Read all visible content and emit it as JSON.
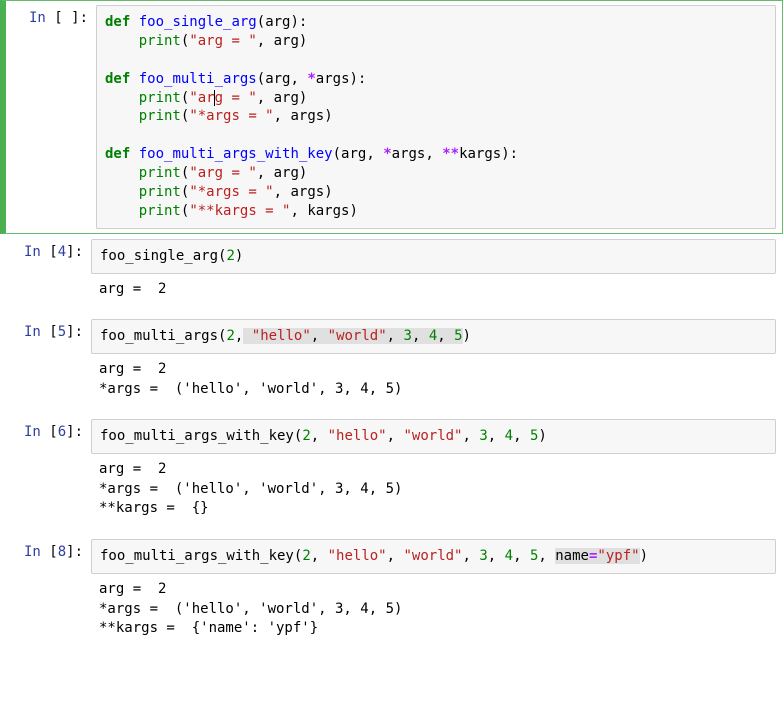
{
  "cells": [
    {
      "selected": true,
      "prompt_label": "In",
      "prompt_num": " ",
      "kind": "code",
      "code_tokens": [
        [
          [
            "kw",
            "def"
          ],
          [
            "pn",
            " "
          ],
          [
            "fn",
            "foo_single_arg"
          ],
          [
            "pn",
            "("
          ],
          [
            "nm",
            "arg"
          ],
          [
            "pn",
            "):"
          ]
        ],
        [
          [
            "pn",
            "    "
          ],
          [
            "bi",
            "print"
          ],
          [
            "pn",
            "("
          ],
          [
            "str",
            "\"arg = \""
          ],
          [
            "pn",
            ", "
          ],
          [
            "nm",
            "arg"
          ],
          [
            "pn",
            ")"
          ]
        ],
        [],
        [
          [
            "kw",
            "def"
          ],
          [
            "pn",
            " "
          ],
          [
            "fn",
            "foo_multi_args"
          ],
          [
            "pn",
            "("
          ],
          [
            "nm",
            "arg"
          ],
          [
            "pn",
            ", "
          ],
          [
            "op",
            "*"
          ],
          [
            "nm",
            "args"
          ],
          [
            "pn",
            "):"
          ]
        ],
        [
          [
            "pn",
            "    "
          ],
          [
            "bi",
            "print"
          ],
          [
            "pn",
            "("
          ],
          [
            "str",
            "\"ar"
          ],
          [
            "cursor",
            ""
          ],
          [
            "str",
            "g = \""
          ],
          [
            "pn",
            ", "
          ],
          [
            "nm",
            "arg"
          ],
          [
            "pn",
            ")"
          ]
        ],
        [
          [
            "pn",
            "    "
          ],
          [
            "bi",
            "print"
          ],
          [
            "pn",
            "("
          ],
          [
            "str",
            "\"*args = \""
          ],
          [
            "pn",
            ", "
          ],
          [
            "nm",
            "args"
          ],
          [
            "pn",
            ")"
          ]
        ],
        [],
        [
          [
            "kw",
            "def"
          ],
          [
            "pn",
            " "
          ],
          [
            "fn",
            "foo_multi_args_with_key"
          ],
          [
            "pn",
            "("
          ],
          [
            "nm",
            "arg"
          ],
          [
            "pn",
            ", "
          ],
          [
            "op",
            "*"
          ],
          [
            "nm",
            "args"
          ],
          [
            "pn",
            ", "
          ],
          [
            "op",
            "**"
          ],
          [
            "nm",
            "kargs"
          ],
          [
            "pn",
            "):"
          ]
        ],
        [
          [
            "pn",
            "    "
          ],
          [
            "bi",
            "print"
          ],
          [
            "pn",
            "("
          ],
          [
            "str",
            "\"arg = \""
          ],
          [
            "pn",
            ", "
          ],
          [
            "nm",
            "arg"
          ],
          [
            "pn",
            ")"
          ]
        ],
        [
          [
            "pn",
            "    "
          ],
          [
            "bi",
            "print"
          ],
          [
            "pn",
            "("
          ],
          [
            "str",
            "\"*args = \""
          ],
          [
            "pn",
            ", "
          ],
          [
            "nm",
            "args"
          ],
          [
            "pn",
            ")"
          ]
        ],
        [
          [
            "pn",
            "    "
          ],
          [
            "bi",
            "print"
          ],
          [
            "pn",
            "("
          ],
          [
            "str",
            "\"**kargs = \""
          ],
          [
            "pn",
            ", "
          ],
          [
            "nm",
            "kargs"
          ],
          [
            "pn",
            ")"
          ]
        ]
      ]
    },
    {
      "selected": false,
      "prompt_label": "In",
      "prompt_num": "4",
      "kind": "code+output",
      "code_tokens": [
        [
          [
            "call",
            "foo_single_arg"
          ],
          [
            "pn",
            "("
          ],
          [
            "num",
            "2"
          ],
          [
            "pn",
            ")"
          ]
        ]
      ],
      "output": "arg =  2"
    },
    {
      "selected": false,
      "prompt_label": "In",
      "prompt_num": "5",
      "kind": "code+output",
      "code_tokens": [
        [
          [
            "call",
            "foo_multi_args"
          ],
          [
            "pn",
            "("
          ],
          [
            "num",
            "2"
          ],
          [
            "pn",
            ","
          ],
          [
            "hl-open",
            ""
          ],
          [
            "pn",
            " "
          ],
          [
            "str",
            "\"hello\""
          ],
          [
            "pn",
            ", "
          ],
          [
            "str",
            "\"world\""
          ],
          [
            "pn",
            ", "
          ],
          [
            "num",
            "3"
          ],
          [
            "pn",
            ", "
          ],
          [
            "num",
            "4"
          ],
          [
            "pn",
            ", "
          ],
          [
            "num",
            "5"
          ],
          [
            "hl-close",
            ""
          ],
          [
            "pn",
            ")"
          ]
        ]
      ],
      "output": "arg =  2\n*args =  ('hello', 'world', 3, 4, 5)"
    },
    {
      "selected": false,
      "prompt_label": "In",
      "prompt_num": "6",
      "kind": "code+output",
      "code_tokens": [
        [
          [
            "call",
            "foo_multi_args_with_key"
          ],
          [
            "pn",
            "("
          ],
          [
            "num",
            "2"
          ],
          [
            "pn",
            ", "
          ],
          [
            "str",
            "\"hello\""
          ],
          [
            "pn",
            ", "
          ],
          [
            "str",
            "\"world\""
          ],
          [
            "pn",
            ", "
          ],
          [
            "num",
            "3"
          ],
          [
            "pn",
            ", "
          ],
          [
            "num",
            "4"
          ],
          [
            "pn",
            ", "
          ],
          [
            "num",
            "5"
          ],
          [
            "pn",
            ")"
          ]
        ]
      ],
      "output": "arg =  2\n*args =  ('hello', 'world', 3, 4, 5)\n**kargs =  {}"
    },
    {
      "selected": false,
      "prompt_label": "In",
      "prompt_num": "8",
      "kind": "code+output",
      "code_tokens": [
        [
          [
            "call",
            "foo_multi_args_with_key"
          ],
          [
            "pn",
            "("
          ],
          [
            "num",
            "2"
          ],
          [
            "pn",
            ", "
          ],
          [
            "str",
            "\"hello\""
          ],
          [
            "pn",
            ", "
          ],
          [
            "str",
            "\"world\""
          ],
          [
            "pn",
            ", "
          ],
          [
            "num",
            "3"
          ],
          [
            "pn",
            ", "
          ],
          [
            "num",
            "4"
          ],
          [
            "pn",
            ", "
          ],
          [
            "num",
            "5"
          ],
          [
            "pn",
            ", "
          ],
          [
            "hl-open",
            ""
          ],
          [
            "nm",
            "name"
          ],
          [
            "op",
            "="
          ],
          [
            "str",
            "\"ypf\""
          ],
          [
            "hl-close",
            ""
          ],
          [
            "pn",
            ")"
          ]
        ]
      ],
      "output": "arg =  2\n*args =  ('hello', 'world', 3, 4, 5)\n**kargs =  {'name': 'ypf'}"
    }
  ]
}
